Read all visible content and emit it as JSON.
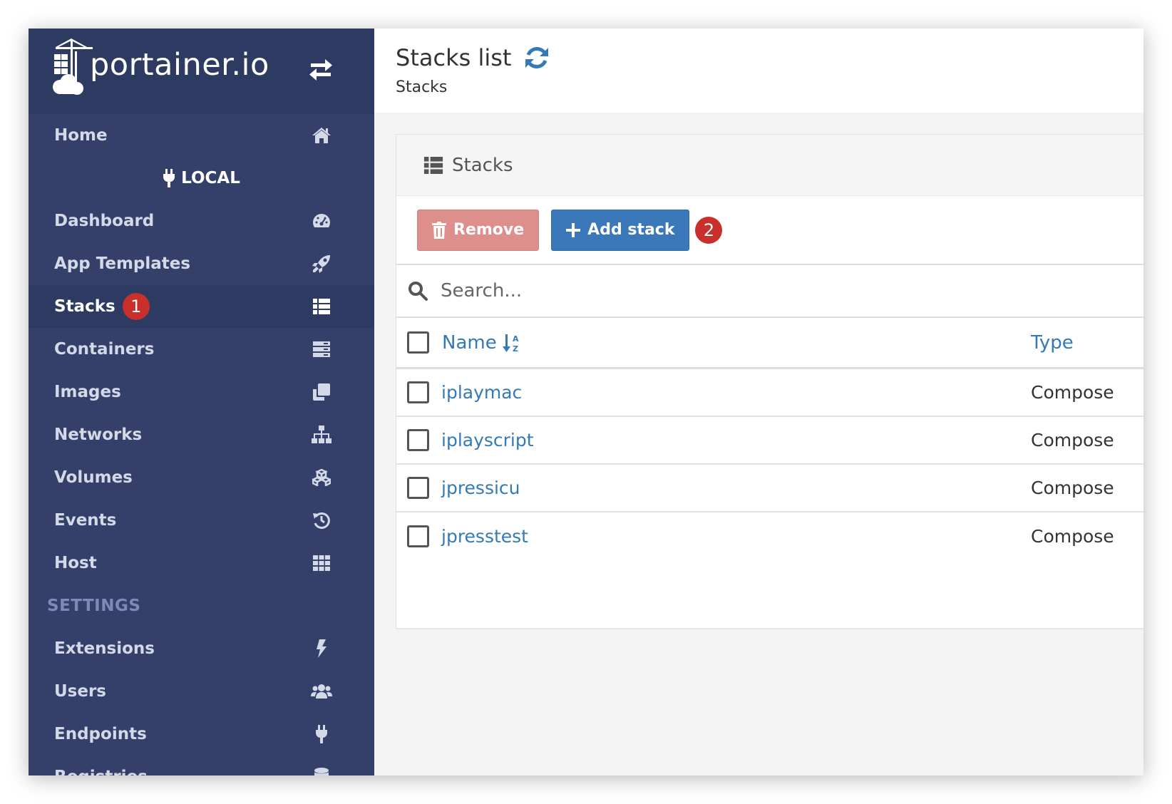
{
  "brand": {
    "name": "portainer.io"
  },
  "sidebar": {
    "home": "Home",
    "endpoint": "LOCAL",
    "items": [
      {
        "label": "Dashboard",
        "icon": "tachometer-icon"
      },
      {
        "label": "App Templates",
        "icon": "rocket-icon"
      },
      {
        "label": "Stacks",
        "icon": "th-list-icon",
        "active": true,
        "badge": "1"
      },
      {
        "label": "Containers",
        "icon": "server-icon"
      },
      {
        "label": "Images",
        "icon": "clone-icon"
      },
      {
        "label": "Networks",
        "icon": "sitemap-icon"
      },
      {
        "label": "Volumes",
        "icon": "cubes-icon"
      },
      {
        "label": "Events",
        "icon": "history-icon"
      },
      {
        "label": "Host",
        "icon": "th-icon"
      }
    ],
    "settings_title": "SETTINGS",
    "settings_items": [
      {
        "label": "Extensions",
        "icon": "bolt-icon"
      },
      {
        "label": "Users",
        "icon": "users-icon"
      },
      {
        "label": "Endpoints",
        "icon": "plug-icon"
      },
      {
        "label": "Registries",
        "icon": "database-icon"
      }
    ]
  },
  "header": {
    "title": "Stacks list",
    "breadcrumb": "Stacks"
  },
  "widget": {
    "title": "Stacks",
    "remove_label": "Remove",
    "add_label": "Add stack",
    "add_badge": "2",
    "search_placeholder": "Search...",
    "columns": {
      "name": "Name",
      "type": "Type"
    },
    "rows": [
      {
        "name": "iplaymac",
        "type": "Compose"
      },
      {
        "name": "iplayscript",
        "type": "Compose"
      },
      {
        "name": "jpressicu",
        "type": "Compose"
      },
      {
        "name": "jpresstest",
        "type": "Compose"
      }
    ]
  },
  "colors": {
    "sidebar_bg": "#34406a",
    "sidebar_active": "#2d3a62",
    "link": "#337ab7",
    "primary": "#3a78b9",
    "danger": "#de8f8c",
    "badge": "#c9302c"
  }
}
